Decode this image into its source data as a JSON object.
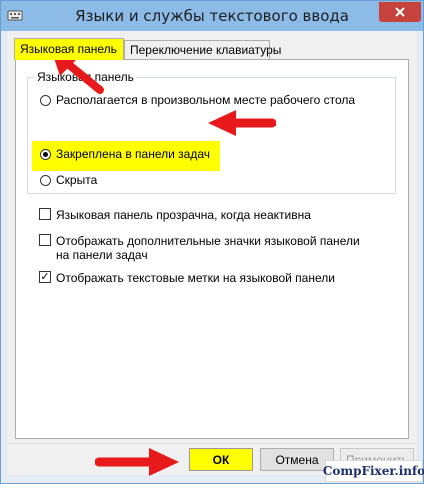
{
  "window": {
    "title": "Языки и службы текстового ввода"
  },
  "tabs": [
    {
      "label": "Языковая панель",
      "active": true
    },
    {
      "label": "Переключение клавиатуры",
      "active": false
    }
  ],
  "language_bar": {
    "group_label": "Языковая панель",
    "position_options": [
      {
        "label": "Располагается в произвольном месте рабочего стола",
        "selected": false
      },
      {
        "label": "Закреплена в панели задач",
        "selected": true
      },
      {
        "label": "Скрыта",
        "selected": false
      }
    ],
    "checkboxes": [
      {
        "label": "Языковая панель прозрачна, когда неактивна",
        "checked": false
      },
      {
        "label": "Отображать дополнительные значки языковой панели на панели задач",
        "checked": false
      },
      {
        "label": "Отображать текстовые метки на языковой панели",
        "checked": true
      }
    ]
  },
  "buttons": {
    "ok": "ОК",
    "cancel": "Отмена",
    "apply": "Применить"
  },
  "watermark": "CompFixer.info",
  "colors": {
    "highlight": "#ffff00",
    "arrow": "#e8191b",
    "titlebar": "#8cbbe8",
    "close_button": "#c7423d"
  },
  "icons": [
    "keyboard-icon",
    "close-icon",
    "arrow-icon"
  ]
}
